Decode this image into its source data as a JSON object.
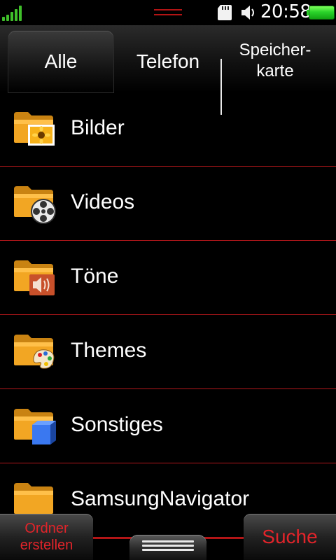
{
  "status": {
    "time": "20:58",
    "icons": [
      "signal-icon",
      "sd-card-icon",
      "speaker-icon",
      "battery-icon"
    ],
    "signal_bars": 5,
    "battery_level": 1.0
  },
  "tabs": [
    {
      "label": "Alle",
      "active": true
    },
    {
      "label": "Telefon",
      "active": false
    },
    {
      "label": "Speicher-\nkarte",
      "active": false
    }
  ],
  "folders": [
    {
      "name": "Bilder",
      "icon": "folder-image-icon"
    },
    {
      "name": "Videos",
      "icon": "folder-video-icon"
    },
    {
      "name": "Töne",
      "icon": "folder-audio-icon"
    },
    {
      "name": "Themes",
      "icon": "folder-themes-icon"
    },
    {
      "name": "Sonstiges",
      "icon": "folder-other-icon"
    },
    {
      "name": "SamsungNavigator",
      "icon": "folder-icon"
    }
  ],
  "bottom": {
    "left_label": "Ordner\nerstellen",
    "right_label": "Suche",
    "menu_icon": "menu-handle-icon"
  },
  "colors": {
    "accent_red": "#b3171b",
    "button_text_red": "#e2242a",
    "signal_green": "#3fbf2a",
    "folder_orange": "#f2a623"
  }
}
